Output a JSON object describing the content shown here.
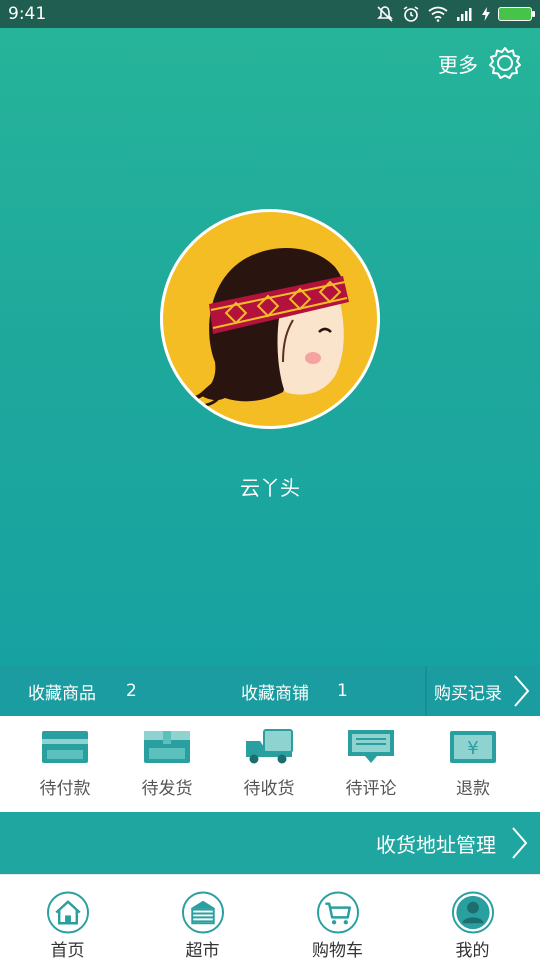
{
  "status_bar": {
    "time": "9:41"
  },
  "header": {
    "more_label": "更多"
  },
  "profile": {
    "username": "云丫头"
  },
  "stats": {
    "fav_goods_label": "收藏商品",
    "fav_goods_count": "2",
    "fav_shops_label": "收藏商铺",
    "fav_shops_count": "1",
    "purchase_history_label": "购买记录"
  },
  "orders": [
    {
      "label": "待付款",
      "icon": "card-icon"
    },
    {
      "label": "待发货",
      "icon": "box-icon"
    },
    {
      "label": "待收货",
      "icon": "truck-icon"
    },
    {
      "label": "待评论",
      "icon": "comment-icon"
    },
    {
      "label": "退款",
      "icon": "yen-icon",
      "icon_text": "¥"
    }
  ],
  "address": {
    "label": "收货地址管理"
  },
  "tabbar": [
    {
      "label": "首页",
      "icon": "home-icon"
    },
    {
      "label": "超市",
      "icon": "store-icon"
    },
    {
      "label": "购物车",
      "icon": "cart-icon"
    },
    {
      "label": "我的",
      "icon": "user-icon"
    }
  ],
  "colors": {
    "primary": "#1fa6a0",
    "status_bar": "#1f5e50",
    "avatar_bg": "#f4bd24",
    "icon_teal": "#2a9fa0"
  }
}
